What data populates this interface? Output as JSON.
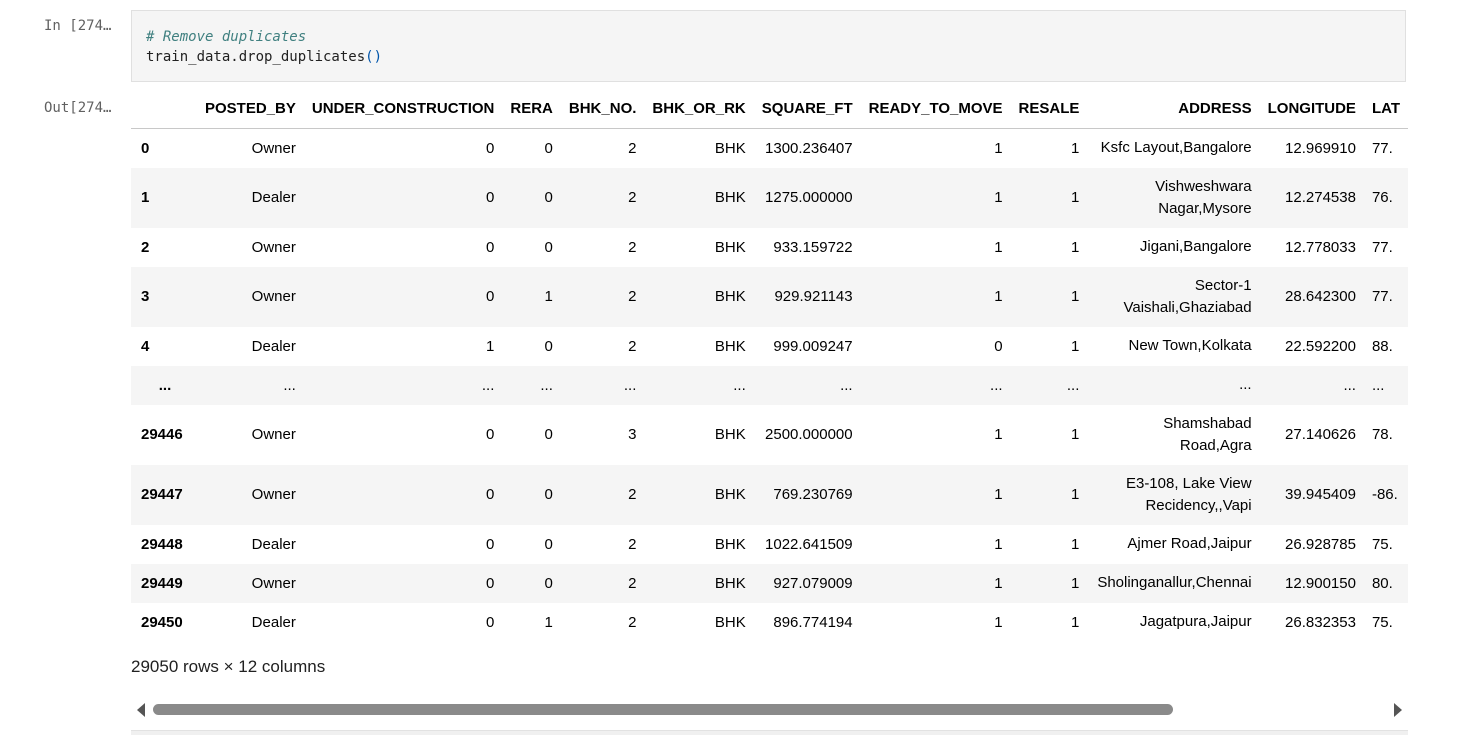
{
  "input_prompt": "In [274…",
  "output_prompt": "Out[274…",
  "code": {
    "comment": "# Remove duplicates",
    "line_fn": "train_data.drop_duplicates",
    "line_parens": "()"
  },
  "table": {
    "columns": [
      "POSTED_BY",
      "UNDER_CONSTRUCTION",
      "RERA",
      "BHK_NO.",
      "BHK_OR_RK",
      "SQUARE_FT",
      "READY_TO_MOVE",
      "RESALE",
      "ADDRESS",
      "LONGITUDE",
      "LAT"
    ],
    "rows": [
      {
        "index": "0",
        "cells": [
          "Owner",
          "0",
          "0",
          "2",
          "BHK",
          "1300.236407",
          "1",
          "1",
          "Ksfc Layout,Bangalore",
          "12.969910",
          "77."
        ],
        "tall": false
      },
      {
        "index": "1",
        "cells": [
          "Dealer",
          "0",
          "0",
          "2",
          "BHK",
          "1275.000000",
          "1",
          "1",
          "Vishweshwara Nagar,Mysore",
          "12.274538",
          "76."
        ],
        "tall": true
      },
      {
        "index": "2",
        "cells": [
          "Owner",
          "0",
          "0",
          "2",
          "BHK",
          "933.159722",
          "1",
          "1",
          "Jigani,Bangalore",
          "12.778033",
          "77."
        ],
        "tall": false
      },
      {
        "index": "3",
        "cells": [
          "Owner",
          "0",
          "1",
          "2",
          "BHK",
          "929.921143",
          "1",
          "1",
          "Sector-1 Vaishali,Ghaziabad",
          "28.642300",
          "77."
        ],
        "tall": true
      },
      {
        "index": "4",
        "cells": [
          "Dealer",
          "1",
          "0",
          "2",
          "BHK",
          "999.009247",
          "0",
          "1",
          "New Town,Kolkata",
          "22.592200",
          "88."
        ],
        "tall": false
      },
      {
        "index": "...",
        "cells": [
          "...",
          "...",
          "...",
          "...",
          "...",
          "...",
          "...",
          "...",
          "...",
          "...",
          "..."
        ],
        "tall": false
      },
      {
        "index": "29446",
        "cells": [
          "Owner",
          "0",
          "0",
          "3",
          "BHK",
          "2500.000000",
          "1",
          "1",
          "Shamshabad Road,Agra",
          "27.140626",
          "78."
        ],
        "tall": true
      },
      {
        "index": "29447",
        "cells": [
          "Owner",
          "0",
          "0",
          "2",
          "BHK",
          "769.230769",
          "1",
          "1",
          "E3-108, Lake View Recidency,,Vapi",
          "39.945409",
          "-86."
        ],
        "tall": true
      },
      {
        "index": "29448",
        "cells": [
          "Dealer",
          "0",
          "0",
          "2",
          "BHK",
          "1022.641509",
          "1",
          "1",
          "Ajmer Road,Jaipur",
          "26.928785",
          "75."
        ],
        "tall": false
      },
      {
        "index": "29449",
        "cells": [
          "Owner",
          "0",
          "0",
          "2",
          "BHK",
          "927.079009",
          "1",
          "1",
          "Sholinganallur,Chennai",
          "12.900150",
          "80."
        ],
        "tall": false
      },
      {
        "index": "29450",
        "cells": [
          "Dealer",
          "0",
          "1",
          "2",
          "BHK",
          "896.774194",
          "1",
          "1",
          "Jagatpura,Jaipur",
          "26.832353",
          "75."
        ],
        "tall": false
      }
    ]
  },
  "rows_info": "29050 rows × 12 columns"
}
